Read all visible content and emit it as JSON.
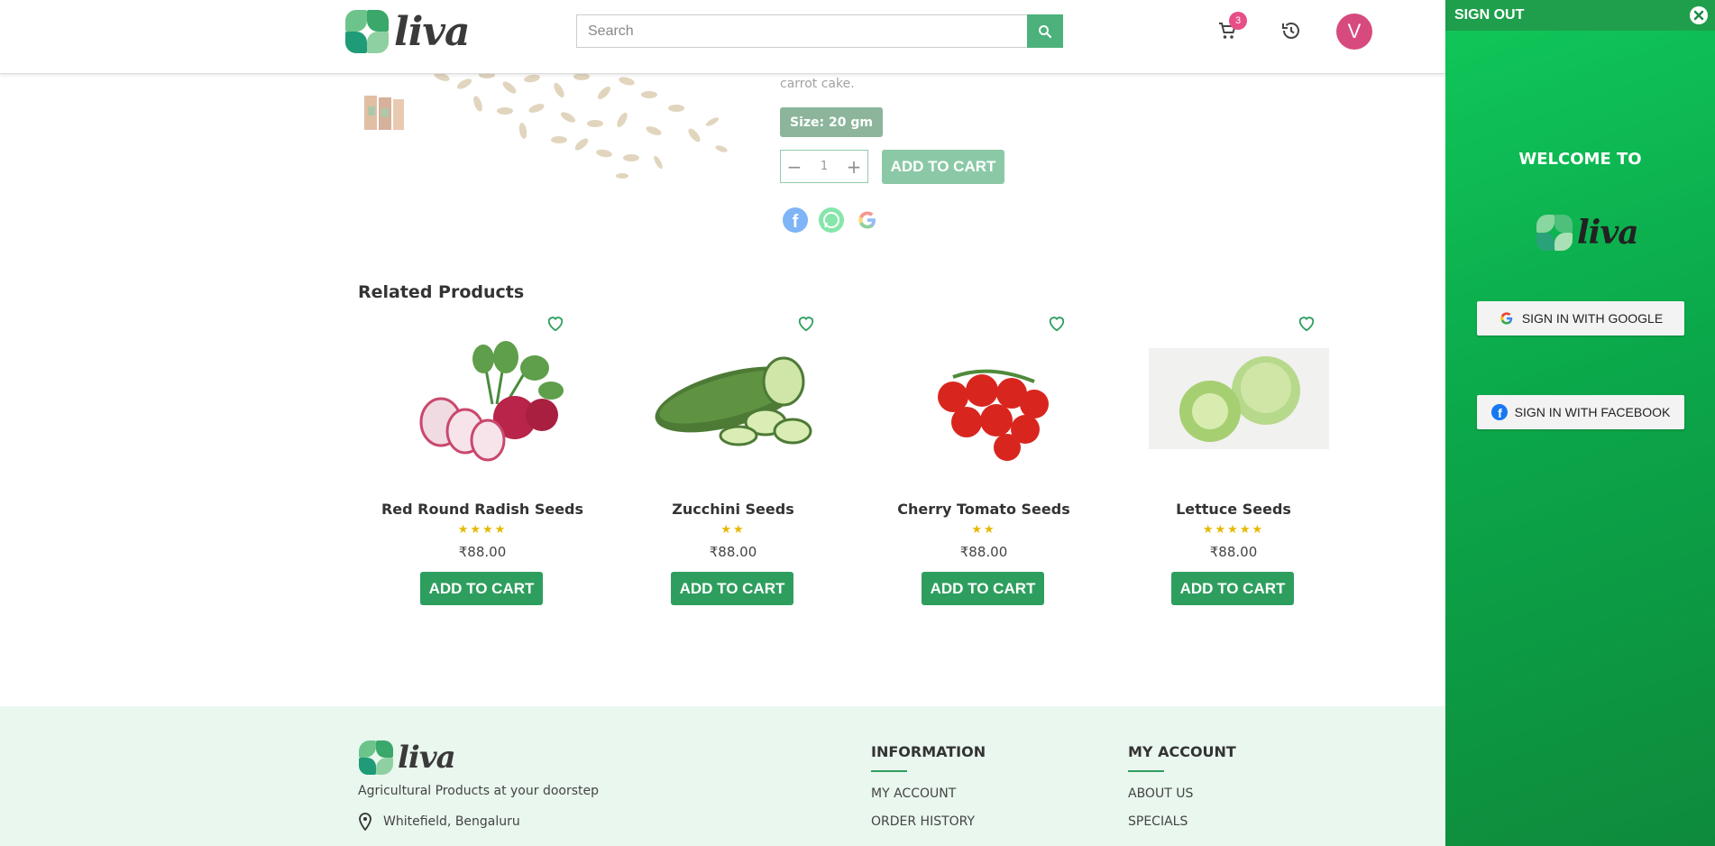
{
  "header": {
    "logo_text": "liva",
    "search_placeholder": "Search",
    "cart_count": "3",
    "avatar_letter": "V"
  },
  "product": {
    "description_tail": "carrot cake.",
    "size_label": "Size: 20 gm",
    "quantity": "1",
    "add_to_cart": "ADD TO CART",
    "share_icons": [
      "facebook-icon",
      "whatsapp-icon",
      "google-icon"
    ]
  },
  "related": {
    "title": "Related Products",
    "items": [
      {
        "name": "Red Round Radish Seeds",
        "stars": "★★★★",
        "price": "₹88.00",
        "button": "ADD TO CART"
      },
      {
        "name": "Zucchini Seeds",
        "stars": "★★",
        "price": "₹88.00",
        "button": "ADD TO CART"
      },
      {
        "name": "Cherry Tomato Seeds",
        "stars": "★★",
        "price": "₹88.00",
        "button": "ADD TO CART"
      },
      {
        "name": "Lettuce Seeds",
        "stars": "★★★★★",
        "price": "₹88.00",
        "button": "ADD TO CART"
      }
    ]
  },
  "footer": {
    "logo_text": "liva",
    "tagline": "Agricultural Products at your doorstep",
    "location": "Whitefield, Bengaluru",
    "information": {
      "title": "INFORMATION",
      "links": [
        "MY ACCOUNT",
        "ORDER HISTORY"
      ]
    },
    "my_account": {
      "title": "MY ACCOUNT",
      "links": [
        "ABOUT US",
        "SPECIALS"
      ]
    }
  },
  "panel": {
    "sign_out": "SIGN OUT",
    "welcome": "WELCOME TO",
    "logo_text": "liva",
    "google_button": "SIGN IN WITH GOOGLE",
    "facebook_button": "SIGN IN WITH FACEBOOK"
  },
  "colors": {
    "brand_green": "#2e9e5e",
    "panel_green": "#0ba84a",
    "badge_pink": "#e84e87",
    "avatar_pink": "#d64a7e",
    "star_yellow": "#e6b800",
    "footer_bg": "#e9f7ee"
  }
}
